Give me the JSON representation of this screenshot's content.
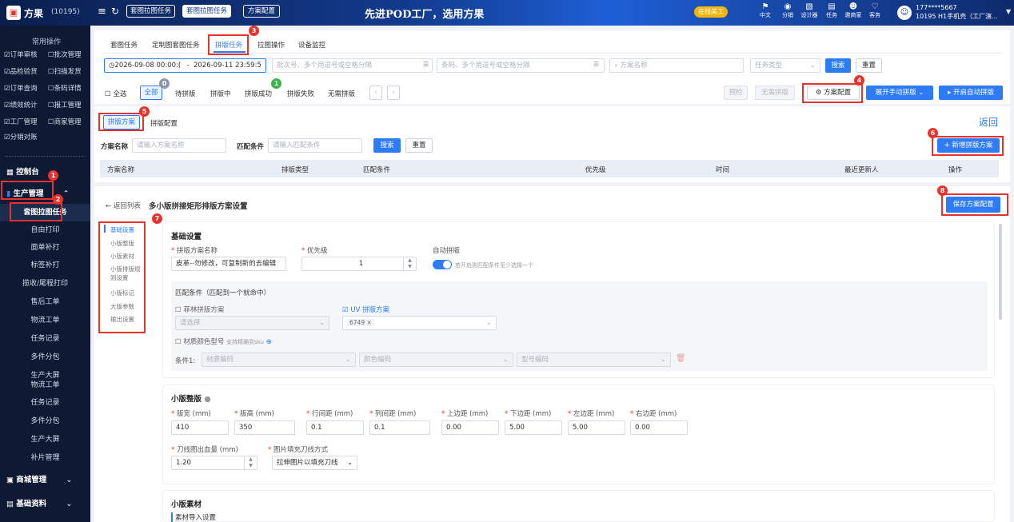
{
  "brand": {
    "name": "方果",
    "code": "(10195)"
  },
  "top": {
    "tabs": [
      "套图拉图任务",
      "套图拉图任务",
      "方案配置"
    ],
    "slogan": "先进POD工厂，选用方果",
    "icons": [
      {
        "label": "中文",
        "icon": "translate-icon"
      },
      {
        "label": "分销",
        "icon": "share-icon"
      },
      {
        "label": "设计器",
        "icon": "design-icon"
      },
      {
        "label": "任务",
        "icon": "task-icon"
      },
      {
        "label": "邀商家",
        "icon": "invite-icon"
      },
      {
        "label": "客务",
        "icon": "service-icon"
      }
    ],
    "user_phone": "177****5667",
    "user_name": "10195 H1手机壳（工厂演...",
    "vip": "在线美工"
  },
  "sidebar": {
    "common_title": "常用操作",
    "grid": [
      [
        "订单审核",
        "批次管理"
      ],
      [
        "品检验货",
        "扫描发货"
      ],
      [
        "订单查询",
        "条码详情"
      ],
      [
        "绩效统计",
        "报工管理"
      ],
      [
        "工厂管理",
        "商家管理"
      ],
      [
        "分销对账",
        ""
      ]
    ],
    "console": "控制台",
    "production": "生产管理",
    "items": [
      "套图拉图任务",
      "自由打印",
      "面单补打",
      "标签补打",
      "揽收/尾程打印",
      "售后工单",
      "物流工单",
      "任务记录",
      "多件分包",
      "生产大屏"
    ],
    "items2": [
      "物流工单",
      "任务记录",
      "多件分包",
      "生产大屏",
      "补片管理"
    ],
    "mall": "商城管理",
    "basic": "基础资料"
  },
  "subtabs": [
    "套图任务",
    "定制图套图任务",
    "拼版任务",
    "拉图操作",
    "设备监控"
  ],
  "filter": {
    "date_start": "2026-09-08 00:00:(",
    "date_sep": "-",
    "date_end": "2026-09-11 23:59:5",
    "batch_ph": "批次号、多个用逗号或空格分隔",
    "barcode_ph": "条码、多个用逗号或空格分隔",
    "plan_ph": "方案名称",
    "task_type_ph": "任务类型",
    "search": "搜索",
    "reset": "重置"
  },
  "status": {
    "select_all": "全选",
    "tabs": [
      "全部",
      "待拼版",
      "拼版中",
      "拼版成功",
      "拼版失败",
      "无需拼版"
    ],
    "pre_check": "预检",
    "no_need": "无需拼版",
    "plan_config": "方案配置",
    "manual": "展开手动拼版",
    "auto": "开启自动拼版"
  },
  "badges": [
    "0",
    "1"
  ],
  "scheme": {
    "tab1": "拼版方案",
    "tab2": "拼版配置",
    "back": "返回",
    "name_label": "方案名称",
    "name_ph": "请输入方案名称",
    "match_label": "匹配条件",
    "match_ph": "请输入匹配条件",
    "search": "搜索",
    "reset": "重置",
    "add": "+ 新增拼版方案",
    "columns": [
      "方案名称",
      "排版类型",
      "匹配条件",
      "优先级",
      "时间",
      "最近更新人",
      "操作"
    ]
  },
  "detail": {
    "back": "返回列表",
    "title": "多小版拼接矩形排版方案设置",
    "save": "保存方案配置",
    "nav": [
      "基础设置",
      "小版整版",
      "小版素材",
      "小版排版规则设置",
      "小版标记",
      "大版参数",
      "输出设置"
    ]
  },
  "basic": {
    "title": "基础设置",
    "name_label": "拼版方案名称",
    "name_value": "皮革--勿修改，可复制新的去编辑",
    "priority_label": "优先级",
    "priority_value": "1",
    "auto_label": "自动拼版",
    "auto_hint": "若开启则匹配条件至少选择一个",
    "match_title": "匹配条件（匹配到一个就命中）",
    "fei_label": "菲林拼版方案",
    "fei_ph": "请选择",
    "uv_label": "UV 拼版方案",
    "uv_tag": "6749 ×",
    "material_label": "材质颜色型号",
    "material_hint": "支持精确到sku",
    "cond_label": "条件1:",
    "mat_code": "材质编码",
    "color_code": "颜色编码",
    "model_code": "型号编码"
  },
  "small": {
    "title": "小版整版",
    "fields": [
      {
        "label": "版宽 (mm)",
        "value": "410"
      },
      {
        "label": "版高 (mm)",
        "value": "350"
      },
      {
        "label": "行间距 (mm)",
        "value": "0.1"
      },
      {
        "label": "列间距 (mm)",
        "value": "0.1"
      },
      {
        "label": "上边距 (mm)",
        "value": "0.00"
      },
      {
        "label": "下边距 (mm)",
        "value": "5.00"
      },
      {
        "label": "左边距 (mm)",
        "value": "5.00"
      },
      {
        "label": "右边距 (mm)",
        "value": "0.00"
      }
    ],
    "bleed_label": "刀线图出血量 (mm)",
    "bleed_value": "1.20",
    "fill_label": "图片填充刀线方式",
    "fill_value": "拉伸图片以填充刀线"
  },
  "material": {
    "title": "小版素材",
    "sub": "素材导入设置"
  },
  "markers": [
    "1",
    "2",
    "3",
    "4",
    "5",
    "6",
    "7",
    "8"
  ]
}
